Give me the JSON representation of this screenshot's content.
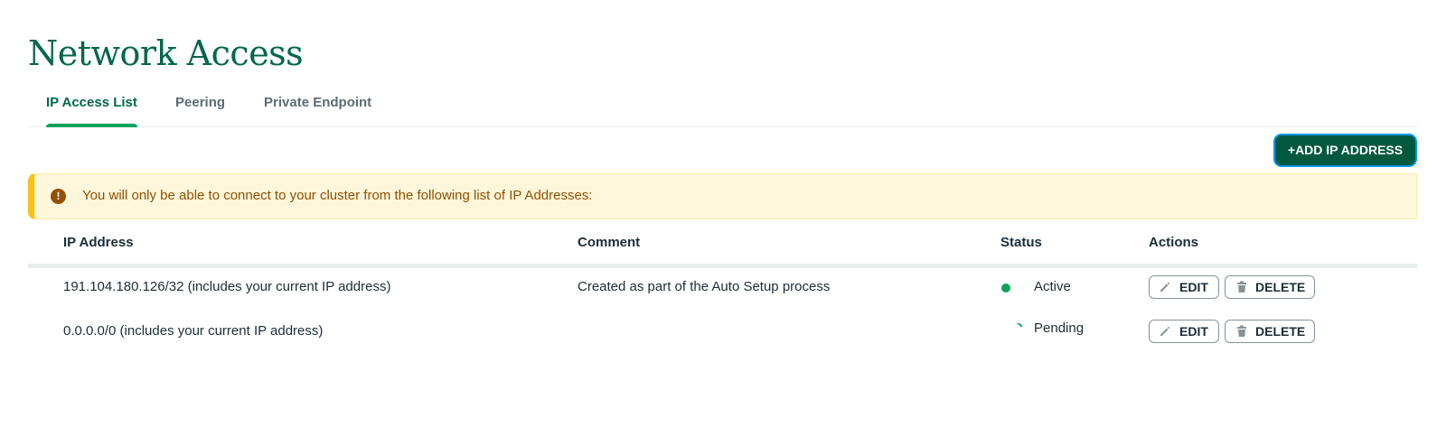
{
  "page": {
    "title": "Network Access"
  },
  "tabs": [
    {
      "label": "IP Access List",
      "active": true
    },
    {
      "label": "Peering",
      "active": false
    },
    {
      "label": "Private Endpoint",
      "active": false
    }
  ],
  "toolbar": {
    "add_label": "+ADD IP ADDRESS"
  },
  "banner": {
    "icon": "warning-icon",
    "message": "You will only be able to connect to your cluster from the following list of IP Addresses:"
  },
  "table": {
    "columns": [
      "IP Address",
      "Comment",
      "Status",
      "Actions"
    ],
    "rows": [
      {
        "ip": "191.104.180.126/32 (includes your current IP address)",
        "comment": "Created as part of the Auto Setup process",
        "status": "Active",
        "status_icon": "active-dot-icon",
        "edit_label": "EDIT",
        "delete_label": "DELETE"
      },
      {
        "ip": "0.0.0.0/0 (includes your current IP address)",
        "comment": "",
        "status": "Pending",
        "status_icon": "pending-spinner-icon",
        "edit_label": "EDIT",
        "delete_label": "DELETE"
      }
    ]
  },
  "colors": {
    "brand_green": "#00684a",
    "accent_green": "#00a35c",
    "button_dark_green": "#00593f",
    "warning_text": "#944f01",
    "warning_bg": "#fef7db"
  }
}
